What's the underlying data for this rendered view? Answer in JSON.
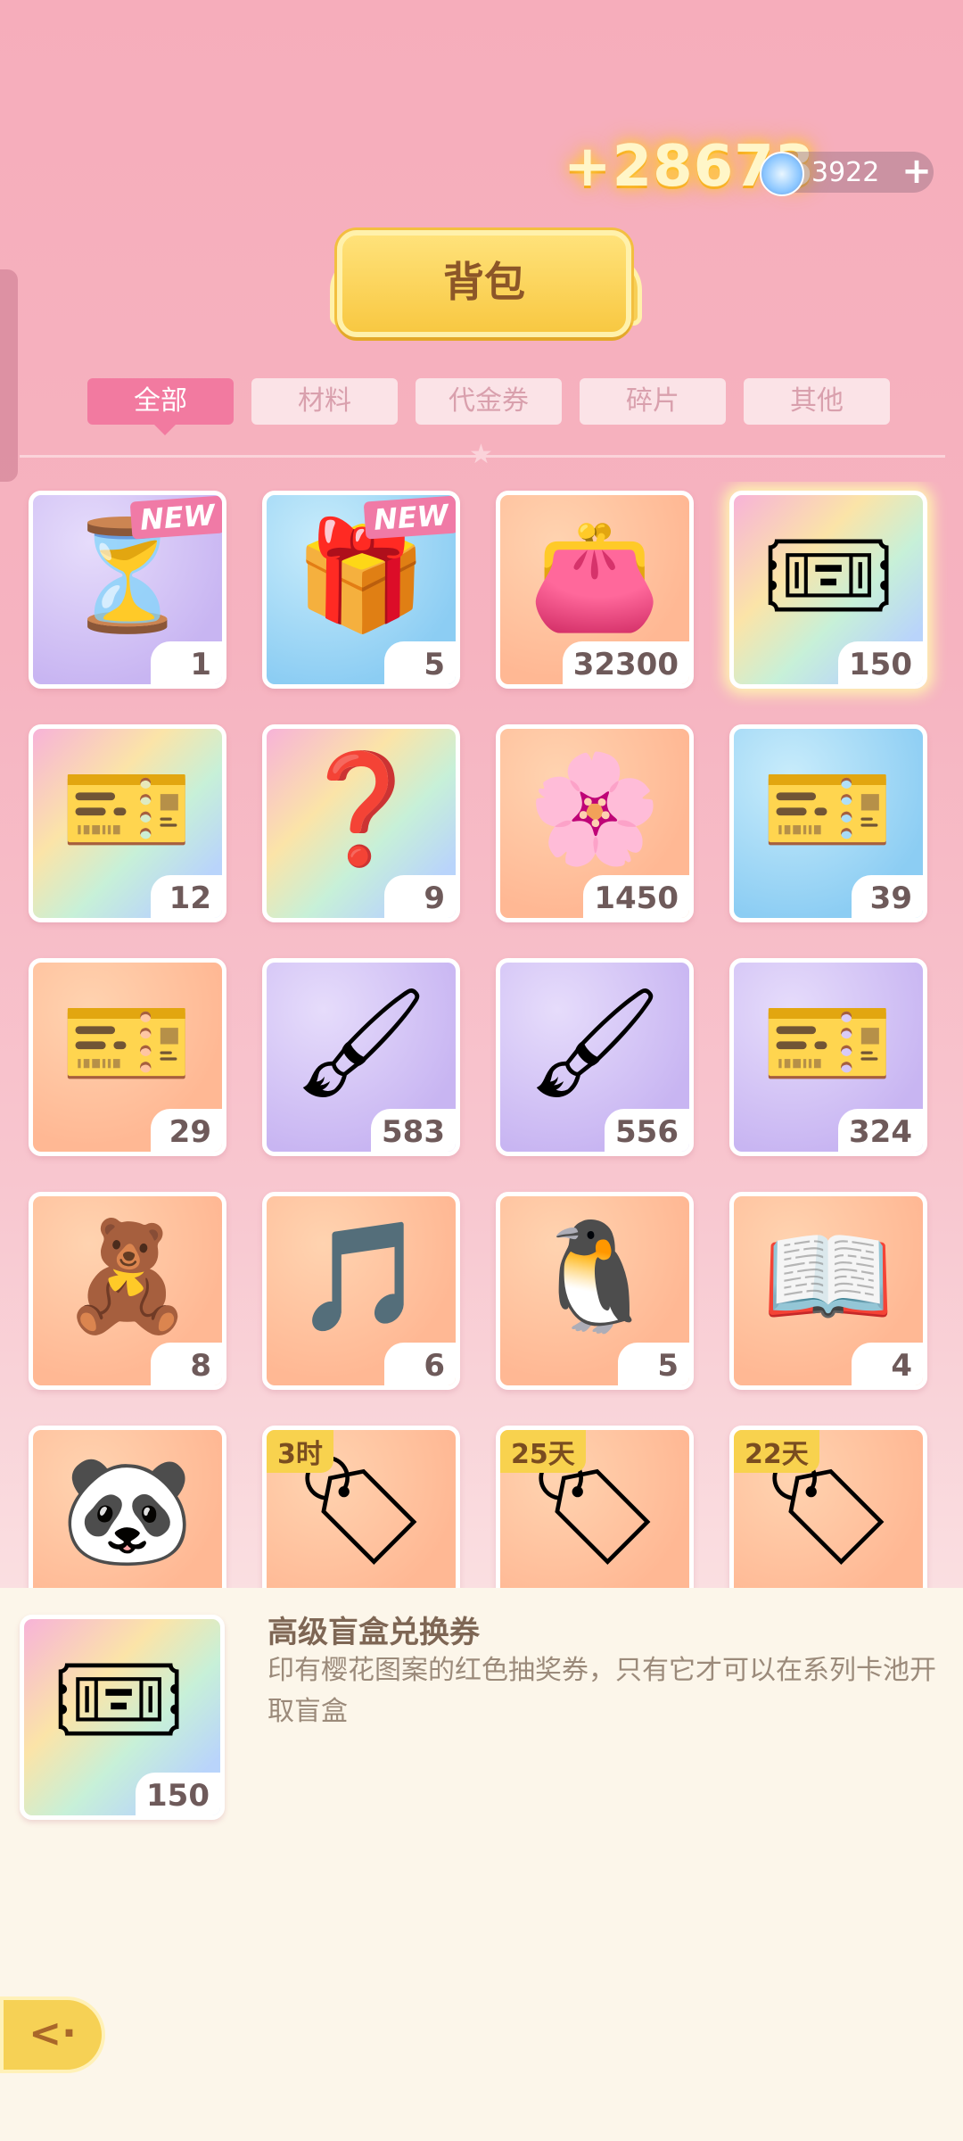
{
  "header": {
    "reward_gain": "+28673",
    "gem_count": "3922",
    "plus_label": "+",
    "title": "背包"
  },
  "tabs": [
    {
      "label": "全部",
      "active": true
    },
    {
      "label": "材料",
      "active": false
    },
    {
      "label": "代金券",
      "active": false
    },
    {
      "label": "碎片",
      "active": false
    },
    {
      "label": "其他",
      "active": false
    }
  ],
  "items": [
    {
      "icon": "hourglass-icon",
      "quantity": "1",
      "tag": "NEW",
      "bg": "purple"
    },
    {
      "icon": "gift-box-icon",
      "quantity": "5",
      "tag": "NEW",
      "bg": "blue"
    },
    {
      "icon": "pink-coin-icon",
      "quantity": "32300",
      "tag": "",
      "bg": "orange"
    },
    {
      "icon": "blind-box-ticket-icon",
      "quantity": "150",
      "tag": "",
      "bg": "rainbow",
      "selected": true
    },
    {
      "icon": "sakura-ticket-icon",
      "quantity": "12",
      "tag": "",
      "bg": "rainbow"
    },
    {
      "icon": "mystery-ticket-icon",
      "quantity": "9",
      "tag": "",
      "bg": "rainbow"
    },
    {
      "icon": "sakura-flower-icon",
      "quantity": "1450",
      "tag": "",
      "bg": "orange"
    },
    {
      "icon": "blue-ticket-icon",
      "quantity": "39",
      "tag": "",
      "bg": "blue"
    },
    {
      "icon": "purple-coupon-icon",
      "quantity": "29",
      "tag": "",
      "bg": "orange"
    },
    {
      "icon": "green-roller-icon",
      "quantity": "583",
      "tag": "",
      "bg": "purple"
    },
    {
      "icon": "pink-roller-icon",
      "quantity": "556",
      "tag": "",
      "bg": "purple"
    },
    {
      "icon": "green-coupon-icon",
      "quantity": "324",
      "tag": "",
      "bg": "purple"
    },
    {
      "icon": "puzzle-box-icon",
      "quantity": "8",
      "tag": "",
      "bg": "orange"
    },
    {
      "icon": "music-book-icon",
      "quantity": "6",
      "tag": "",
      "bg": "orange"
    },
    {
      "icon": "penguin-drink-icon",
      "quantity": "5",
      "tag": "",
      "bg": "orange"
    },
    {
      "icon": "sketchbook-icon",
      "quantity": "4",
      "tag": "",
      "bg": "orange"
    },
    {
      "icon": "panda-plush-icon",
      "quantity": "",
      "tag": "",
      "bg": "orange"
    },
    {
      "icon": "sale-coupon-icon",
      "quantity": "",
      "timer": "3时",
      "bg": "orange"
    },
    {
      "icon": "sale-coupon-icon",
      "quantity": "",
      "timer": "25天",
      "bg": "orange"
    },
    {
      "icon": "sale-coupon-icon",
      "quantity": "",
      "timer": "22天",
      "bg": "orange"
    }
  ],
  "detail": {
    "icon": "blind-box-ticket-icon",
    "quantity": "150",
    "name": "高级盲盒兑换券",
    "description": "印有樱花图案的红色抽奖券，只有它才可以在系列卡池开取盲盒"
  },
  "back_button": {
    "icon": "back-arrow-icon"
  }
}
